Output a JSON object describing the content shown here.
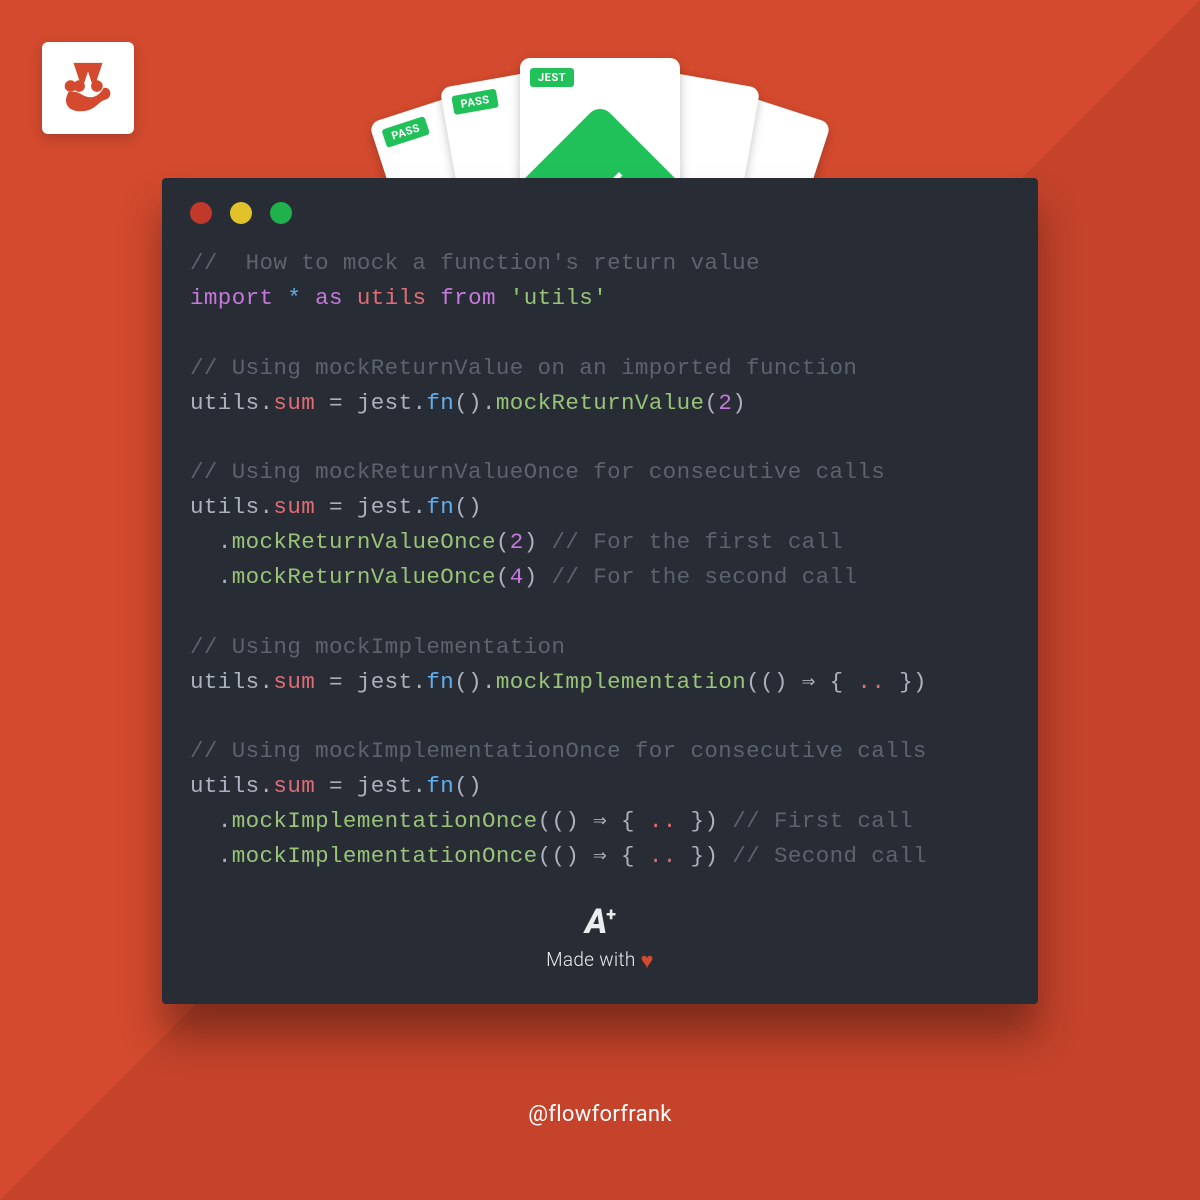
{
  "badges": {
    "pass": "PASS",
    "jest": "JEST"
  },
  "code": {
    "l1_comment": "//  How to mock a function's return value",
    "l2_import": "import",
    "l2_star": "*",
    "l2_as": "as",
    "l2_utils": "utils",
    "l2_from": "from",
    "l2_src": "'utils'",
    "l4_comment": "// Using mockReturnValue on an imported function",
    "l5_obj": "utils",
    "l5_prop": "sum",
    "l5_jest": "jest",
    "l5_fn": "fn",
    "l5_method": "mockReturnValue",
    "l5_num": "2",
    "l7_comment": "// Using mockReturnValueOnce for consecutive calls",
    "l8_obj": "utils",
    "l8_prop": "sum",
    "l8_jest": "jest",
    "l8_fn": "fn",
    "l9_method": "mockReturnValueOnce",
    "l9_num": "2",
    "l9_c": " // For the first call",
    "l10_method": "mockReturnValueOnce",
    "l10_num": "4",
    "l10_c": " // For the second call",
    "l12_comment": "// Using mockImplementation",
    "l13_obj": "utils",
    "l13_prop": "sum",
    "l13_jest": "jest",
    "l13_fn": "fn",
    "l13_method": "mockImplementation",
    "l13_arrow": "() ⇒ { ",
    "l13_dots": "..",
    "l13_close": " })",
    "l15_comment": "// Using mockImplementationOnce for consecutive calls",
    "l16_obj": "utils",
    "l16_prop": "sum",
    "l16_jest": "jest",
    "l16_fn": "fn",
    "l17_method": "mockImplementationOnce",
    "l17_arrow": "(() ⇒ { ",
    "l17_dots": "..",
    "l17_close": " })",
    "l17_c": " // First call",
    "l18_method": "mockImplementationOnce",
    "l18_arrow": "(() ⇒ { ",
    "l18_dots": "..",
    "l18_close": " })",
    "l18_c": " // Second call"
  },
  "footer": {
    "aplus_main": "A",
    "aplus_sup": "+",
    "made_with": "Made with ",
    "heart": "♥"
  },
  "handle": "@flowforfrank"
}
